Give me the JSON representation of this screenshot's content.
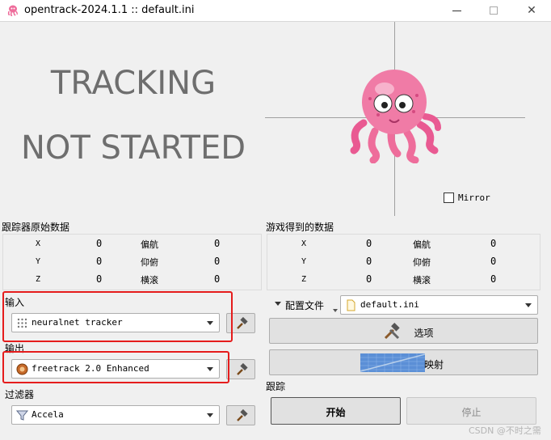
{
  "window": {
    "title": "opentrack-2024.1.1 :: default.ini",
    "min_label": "",
    "max_label": "",
    "close_label": "✕"
  },
  "status": {
    "line1": "TRACKING",
    "line2": "NOT STARTED"
  },
  "pose": {
    "mirror_label": "Mirror",
    "mirror_checked": false
  },
  "raw_tracker": {
    "label": "跟踪器原始数据",
    "rows": [
      {
        "axis": "X",
        "value": "0",
        "angle": "偏航",
        "angle_value": "0"
      },
      {
        "axis": "Y",
        "value": "0",
        "angle": "仰俯",
        "angle_value": "0"
      },
      {
        "axis": "Z",
        "value": "0",
        "angle": "横滚",
        "angle_value": "0"
      }
    ]
  },
  "game_data": {
    "label": "游戏得到的数据",
    "rows": [
      {
        "axis": "X",
        "value": "0",
        "angle": "偏航",
        "angle_value": "0"
      },
      {
        "axis": "Y",
        "value": "0",
        "angle": "仰俯",
        "angle_value": "0"
      },
      {
        "axis": "Z",
        "value": "0",
        "angle": "横滚",
        "angle_value": "0"
      }
    ]
  },
  "input": {
    "label": "输入",
    "selected": "neuralnet tracker"
  },
  "output": {
    "label": "输出",
    "selected": "freetrack 2.0 Enhanced"
  },
  "filter": {
    "label": "过滤器",
    "selected": "Accela"
  },
  "profile": {
    "label": "配置文件",
    "selected": "default.ini"
  },
  "buttons": {
    "options": "选项",
    "mapping": "映射",
    "start": "开始",
    "stop": "停止"
  },
  "tracking": {
    "label": "跟踪"
  },
  "watermark": "CSDN @不时之需"
}
